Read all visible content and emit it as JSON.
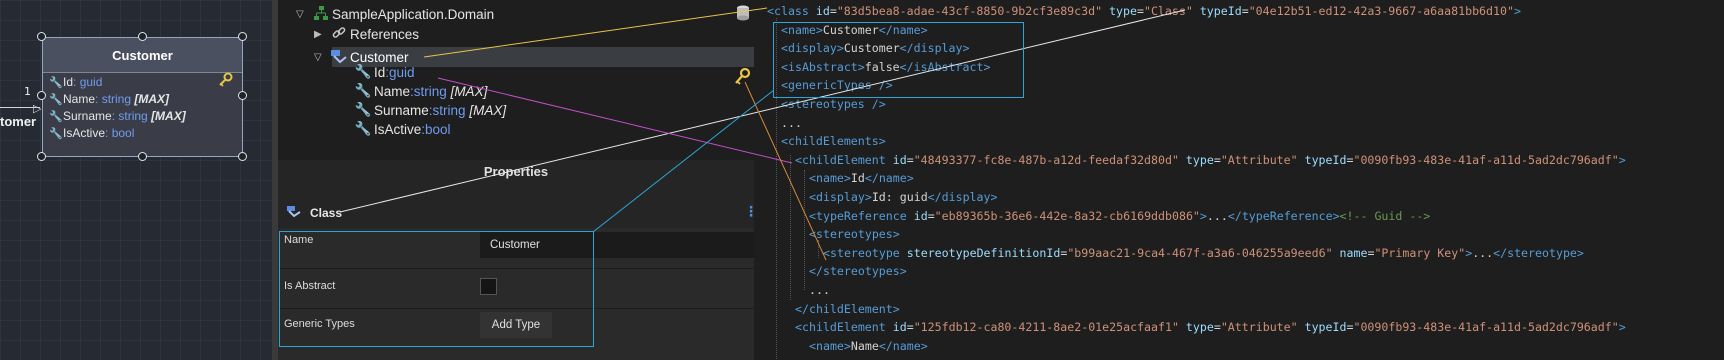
{
  "diagram": {
    "class_title": "Customer",
    "attributes": [
      {
        "name": "Id",
        "sep": ": ",
        "type": "guid",
        "modifier": ""
      },
      {
        "name": "Name",
        "sep": ": ",
        "type": "string",
        "modifier": "[MAX]"
      },
      {
        "name": "Surname",
        "sep": ": ",
        "type": "string",
        "modifier": "[MAX]"
      },
      {
        "name": "IsActive",
        "sep": ": ",
        "type": "bool",
        "modifier": ""
      }
    ],
    "multiplicity": "1",
    "external_label": "tomer"
  },
  "tree": {
    "root": "SampleApplication.Domain",
    "references": "References",
    "selected": "Customer",
    "attributes": [
      {
        "name": "Id",
        "sep": ": ",
        "type": "guid",
        "modifier": ""
      },
      {
        "name": "Name",
        "sep": ": ",
        "type": "string",
        "modifier": "[MAX]"
      },
      {
        "name": "Surname",
        "sep": ": ",
        "type": "string",
        "modifier": "[MAX]"
      },
      {
        "name": "IsActive",
        "sep": ": ",
        "type": "bool",
        "modifier": ""
      }
    ]
  },
  "properties": {
    "title": "Properties",
    "kind": "Class",
    "menu_glyph": "⋮",
    "name_label": "Name",
    "name_value": "Customer",
    "is_abstract_label": "Is Abstract",
    "generic_types_label": "Generic Types",
    "add_type_label": "Add Type"
  },
  "xml_lines": [
    "<class id=\"83d5bea8-adae-43cf-8850-9b2cf3e89c3d\" type=\"Class\" typeId=\"04e12b51-ed12-42a3-9667-a6aa81bb6d10\">",
    "  <name>Customer</name>",
    "  <display>Customer</display>",
    "  <isAbstract>false</isAbstract>",
    "  <genericTypes />",
    "  <stereotypes />",
    "  ...",
    "  <childElements>",
    "    <childElement id=\"48493377-fc8e-487b-a12d-feedaf32d80d\" type=\"Attribute\" typeId=\"0090fb93-483e-41af-a11d-5ad2dc796adf\">",
    "      <name>Id</name>",
    "      <display>Id: guid</display>",
    "      <typeReference id=\"eb89365b-36e6-442e-8a32-cb6169ddb086\">...</typeReference><!-- Guid -->",
    "      <stereotypes>",
    "        <stereotype stereotypeDefinitionId=\"b99aac21-9ca4-467f-a3a6-046255a9eed6\" name=\"Primary Key\">...</stereotype>",
    "      </stereotypes>",
    "      ...",
    "    </childElement>",
    "    <childElement id=\"125fdb12-ca80-4211-8ae2-01e25acfaaf1\" type=\"Attribute\" typeId=\"0090fb93-483e-41af-a11d-5ad2dc796adf\">",
    "      <name>Name</name>"
  ],
  "colors": {
    "xml_tag": "#569cd6",
    "xml_attr": "#9cdcfe",
    "xml_value": "#ce9178",
    "xml_comment": "#6a9955",
    "type_blue": "#6f9cf0",
    "highlight_box": "#2aa7d8",
    "connector_yellow": "#e8c547",
    "connector_magenta": "#c24fc9",
    "connector_orange": "#d68a3a",
    "connector_cyan": "#2aa7d8"
  }
}
